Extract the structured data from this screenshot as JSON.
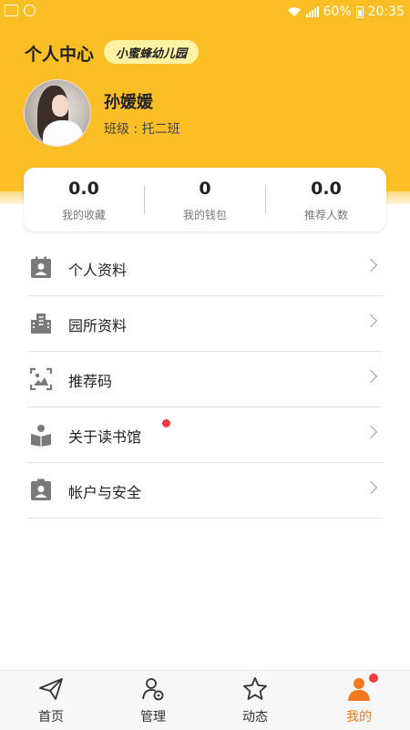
{
  "status_bar": {
    "battery": "60%",
    "time": "20:35"
  },
  "header": {
    "title": "个人中心",
    "school_name": "小蜜蜂幼儿园"
  },
  "profile": {
    "name": "孙媛媛",
    "class_text": "班级 : 托二班"
  },
  "stats": [
    {
      "value": "0.0",
      "label": "我的收藏"
    },
    {
      "value": "0",
      "label": "我的钱包"
    },
    {
      "value": "0.0",
      "label": "推荐人数"
    }
  ],
  "menu": [
    {
      "label": "个人资料",
      "icon": "profile-card-icon"
    },
    {
      "label": "园所资料",
      "icon": "building-icon"
    },
    {
      "label": "推荐码",
      "icon": "image-frame-icon"
    },
    {
      "label": "关于读书馆",
      "icon": "book-reader-icon",
      "badge": true
    },
    {
      "label": "帐户与安全",
      "icon": "account-lock-icon"
    }
  ],
  "bottom_nav": [
    {
      "label": "首页",
      "icon": "paper-plane-icon",
      "active": false
    },
    {
      "label": "管理",
      "icon": "user-gear-icon",
      "active": false
    },
    {
      "label": "动态",
      "icon": "star-icon",
      "active": false
    },
    {
      "label": "我的",
      "icon": "person-icon",
      "active": true,
      "badge": true
    }
  ],
  "colors": {
    "header_yellow": "#FBBE24",
    "badge_yellow": "#FFF2A3",
    "active_orange": "#F7771F",
    "badge_red": "#EF3B3B"
  }
}
